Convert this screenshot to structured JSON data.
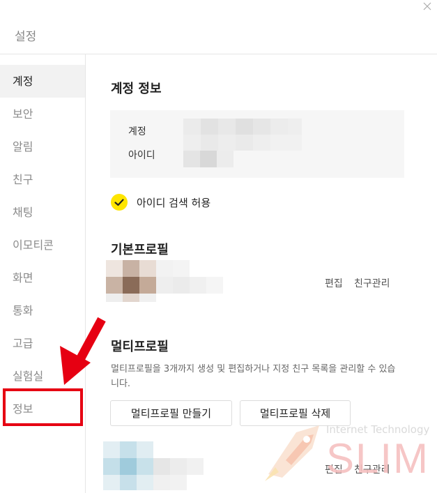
{
  "window": {
    "title": "설정"
  },
  "sidebar": {
    "items": [
      {
        "label": "계정",
        "active": true
      },
      {
        "label": "보안",
        "active": false
      },
      {
        "label": "알림",
        "active": false
      },
      {
        "label": "친구",
        "active": false
      },
      {
        "label": "채팅",
        "active": false
      },
      {
        "label": "이모티콘",
        "active": false
      },
      {
        "label": "화면",
        "active": false
      },
      {
        "label": "통화",
        "active": false
      },
      {
        "label": "고급",
        "active": false
      },
      {
        "label": "실험실",
        "active": false
      },
      {
        "label": "정보",
        "active": false
      }
    ]
  },
  "account_info": {
    "title": "계정 정보",
    "account_label": "계정",
    "id_label": "아이디",
    "id_search_label": "아이디 검색 허용",
    "id_search_checked": true
  },
  "basic_profile": {
    "title": "기본프로필",
    "edit_label": "편집",
    "friends_label": "친구관리"
  },
  "multi_profile": {
    "title": "멀티프로필",
    "description": "멀티프로필을 3개까지 생성 및 편집하거나 지정 친구 목록을 관리할 수 있습니다.",
    "create_label": "멀티프로필 만들기",
    "delete_label": "멀티프로필 삭제",
    "edit_label": "편집",
    "friends_label": "친구관리"
  },
  "watermark": {
    "line1": "Internet Technology",
    "line2": "SLIM"
  },
  "colors": {
    "accent": "#fee500",
    "annotation": "#e60012",
    "active_bg": "#f2f2f2"
  },
  "icons": {
    "close": "close-icon",
    "check": "check-icon",
    "rocket": "rocket-icon"
  }
}
